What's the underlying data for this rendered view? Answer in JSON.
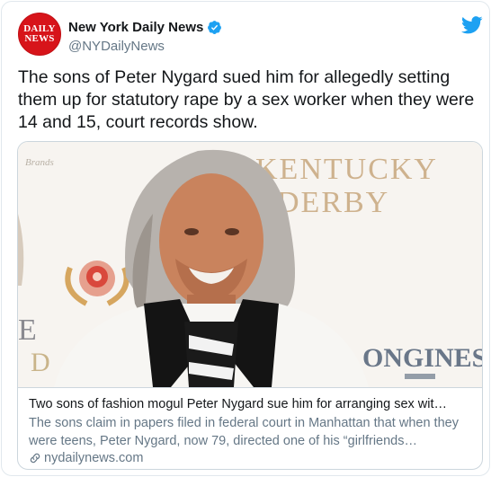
{
  "account": {
    "display_name": "New York Daily News",
    "handle": "@NYDailyNews",
    "avatar_line1": "DAILY",
    "avatar_line2": "NEWS",
    "verified": true
  },
  "tweet": {
    "text": "The sons of Peter Nygard sued him for allegedly setting them up for statutory rape by a sex worker when they were 14 and 15, court records show."
  },
  "card": {
    "image_texts": {
      "backdrop_word1": "KENTUCKY",
      "backdrop_word2": "DERBY",
      "sponsor": "ONGINES",
      "brands": "Brands"
    },
    "title": "Two sons of fashion mogul Peter Nygard sue him for arranging sex wit…",
    "description": "The sons claim in papers filed in federal court in Manhattan that when they were teens, Peter Nygard, now 79, directed one of his “girlfriends…",
    "domain": "nydailynews.com"
  },
  "icons": {
    "verified": "verified-badge-icon",
    "platform": "twitter-bird-icon",
    "link": "link-icon"
  },
  "colors": {
    "twitter_blue": "#1da1f2",
    "avatar_red": "#d7141a",
    "secondary_text": "#657786",
    "border": "#e1e8ed"
  }
}
